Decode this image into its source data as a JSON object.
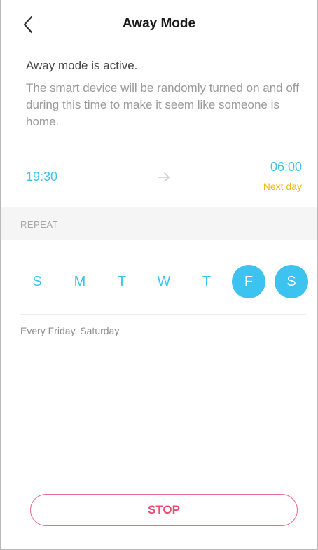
{
  "header": {
    "back_icon": "chevron-left-icon",
    "title": "Away Mode"
  },
  "status": {
    "title": "Away mode is active.",
    "description": "The smart device will be randomly turned on and off during this time to make it seem like someone is home."
  },
  "schedule": {
    "start_time": "19:30",
    "arrow_icon": "arrow-right-icon",
    "end_time": "06:00",
    "end_note": "Next day"
  },
  "repeat": {
    "label": "REPEAT",
    "days": [
      {
        "label": "S",
        "selected": false
      },
      {
        "label": "M",
        "selected": false
      },
      {
        "label": "T",
        "selected": false
      },
      {
        "label": "W",
        "selected": false
      },
      {
        "label": "T",
        "selected": false
      },
      {
        "label": "F",
        "selected": true
      },
      {
        "label": "S",
        "selected": true
      }
    ],
    "summary": "Every Friday, Saturday"
  },
  "actions": {
    "stop_label": "STOP"
  },
  "colors": {
    "accent": "#3cc3f0",
    "next_day": "#f5b80e",
    "stop": "#ee4d72"
  }
}
